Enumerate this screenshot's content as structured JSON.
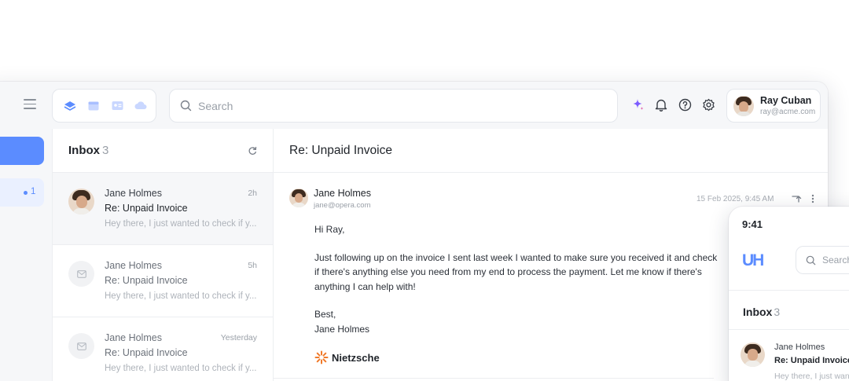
{
  "topbar": {
    "search_placeholder": "Search",
    "account": {
      "name": "Ray Cuban",
      "email": "ray@acme.com"
    }
  },
  "sidebar": {
    "nav_count": "1"
  },
  "list": {
    "title": "Inbox",
    "count": "3",
    "items": [
      {
        "sender": "Jane Holmes",
        "time": "2h",
        "subject": "Re: Unpaid Invoice",
        "snippet": "Hey there, I just wanted to check if y..."
      },
      {
        "sender": "Jane Holmes",
        "time": "5h",
        "subject": "Re: Unpaid Invoice",
        "snippet": "Hey there, I just wanted to check if y..."
      },
      {
        "sender": "Jane Holmes",
        "time": "Yesterday",
        "subject": "Re: Unpaid Invoice",
        "snippet": "Hey there, I just wanted to check if y..."
      }
    ]
  },
  "reader": {
    "title": "Re: Unpaid Invoice",
    "sender_name": "Jane Holmes",
    "sender_email": "jane@opera.com",
    "date": "15 Feb 2025, 9:45 AM",
    "greeting": "Hi Ray,",
    "body": "Just following up on the invoice I sent last week I wanted to make sure you received it and check if there's anything else you need from my end to process the payment. Let me know if there's anything I can help with!",
    "closing": "Best,",
    "signoff_name": "Jane Holmes",
    "signature_brand": "Nietzsche"
  },
  "phone": {
    "time": "9:41",
    "logo": "UH",
    "search_placeholder": "Search",
    "inbox_title": "Inbox",
    "inbox_count": "3",
    "item": {
      "sender": "Jane Holmes",
      "subject": "Re: Unpaid Invoice",
      "snippet": "Hey there, I just wanted to check if y..."
    }
  },
  "colors": {
    "accent": "#5b8cff",
    "sparkle": "#7c5cff",
    "brand_orange": "#f07a2a"
  },
  "icons": [
    "menu-icon",
    "layers-icon",
    "calendar-icon",
    "contacts-icon",
    "cloud-icon",
    "search-icon",
    "sparkle-icon",
    "bell-icon",
    "help-icon",
    "gear-icon",
    "refresh-icon",
    "mail-icon",
    "reply-icon",
    "more-icon"
  ]
}
